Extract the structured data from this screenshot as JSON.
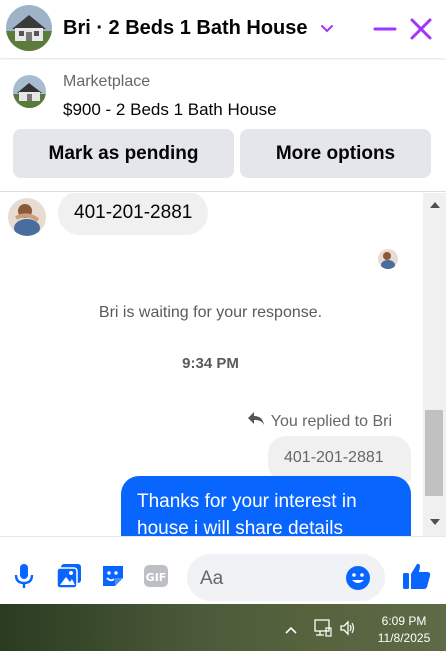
{
  "header": {
    "title": "Bri · 2 Beds 1 Bath House",
    "accent_color": "#a033ff"
  },
  "marketplace": {
    "label": "Marketplace",
    "listing": "$900 - 2 Beds 1 Bath House",
    "pending_button": "Mark as pending",
    "more_button": "More options"
  },
  "messages": {
    "incoming_text": "401-201-2881",
    "waiting_note": "Bri is waiting for your response.",
    "timestamp": "9:34 PM",
    "replied_label": "You replied to Bri",
    "quoted_text": "401-201-2881",
    "outgoing_text": "Thanks for your interest in house i will share details"
  },
  "composer": {
    "placeholder": "Aa",
    "icons": [
      "microphone-icon",
      "photo-icon",
      "sticker-icon",
      "gif-icon",
      "emoji-icon",
      "like-icon"
    ],
    "gif_label": "GIF",
    "brand_color": "#0866ff"
  },
  "taskbar": {
    "time": "6:09 PM",
    "date": "11/8/2025"
  }
}
